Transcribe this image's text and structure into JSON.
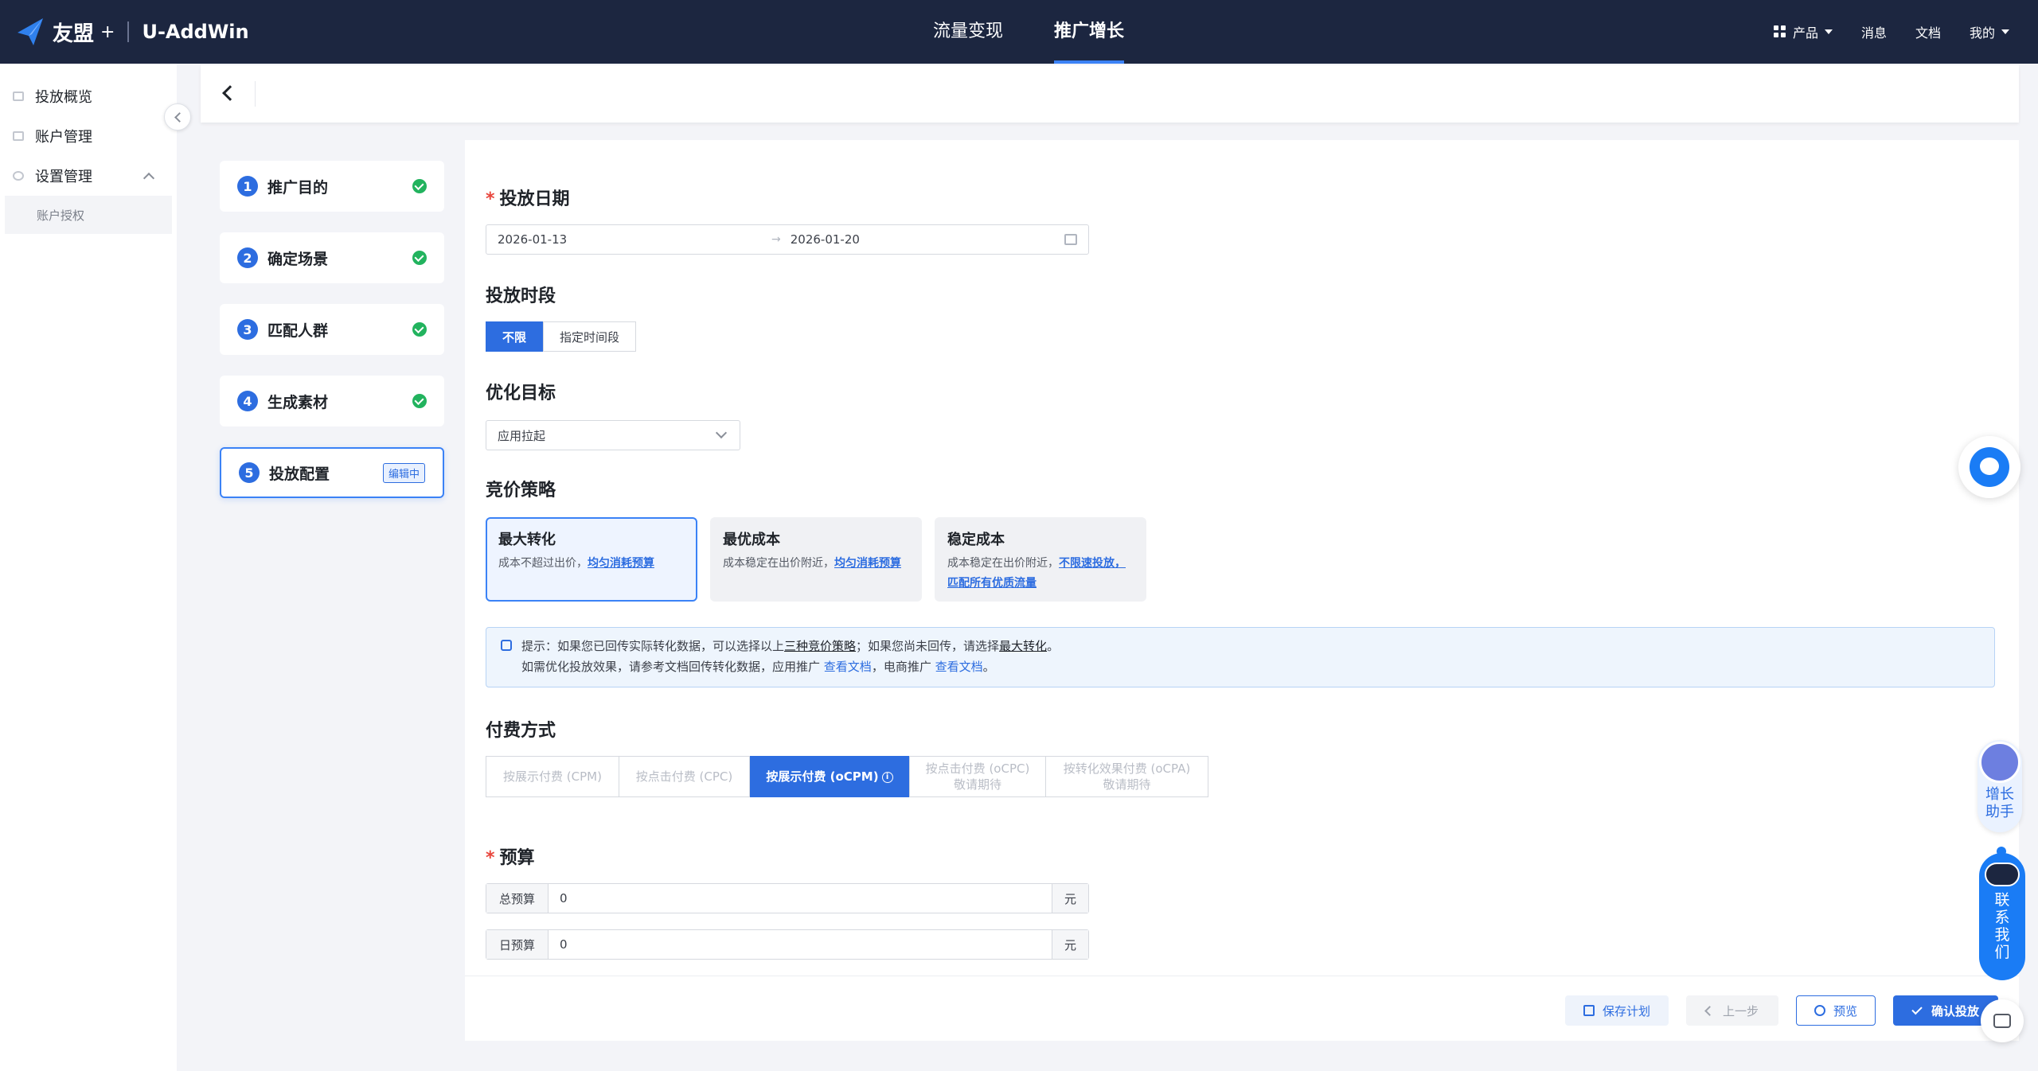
{
  "header": {
    "brand": "友盟",
    "brand_plus": "+",
    "app_name": "U-AddWin",
    "nav": [
      "流量变现",
      "推广增长"
    ],
    "active_nav": "推广增长",
    "right": {
      "product": "产品",
      "messages": "消息",
      "docs": "文档",
      "mine": "我的"
    }
  },
  "sidebar": {
    "items": [
      {
        "label": "投放概览"
      },
      {
        "label": "账户管理"
      },
      {
        "label": "设置管理"
      }
    ],
    "sub_items": [
      {
        "label": "账户授权"
      }
    ]
  },
  "steps": [
    {
      "num": "1",
      "label": "推广目的",
      "status": "done"
    },
    {
      "num": "2",
      "label": "确定场景",
      "status": "done"
    },
    {
      "num": "3",
      "label": "匹配人群",
      "status": "done"
    },
    {
      "num": "4",
      "label": "生成素材",
      "status": "done"
    },
    {
      "num": "5",
      "label": "投放配置",
      "status": "editing",
      "badge": "编辑中"
    }
  ],
  "form": {
    "date": {
      "label": "投放日期",
      "start": "2026-01-13",
      "arrow": "→",
      "end": "2026-01-20"
    },
    "time_slot": {
      "label": "投放时段",
      "options": [
        "不限",
        "指定时间段"
      ],
      "selected": "不限"
    },
    "goal": {
      "label": "优化目标",
      "value": "应用拉起"
    },
    "bid_strategy": {
      "label": "竞价策略",
      "options": [
        {
          "title": "最大转化",
          "desc": "成本不超过出价，",
          "link": "均匀消耗预算",
          "desc2": ""
        },
        {
          "title": "最优成本",
          "desc": "成本稳定在出价附近，",
          "link": "均匀消耗预算",
          "desc2": ""
        },
        {
          "title": "稳定成本",
          "desc": "成本稳定在出价附近，",
          "link": "不限速投放，匹配所有优质流量",
          "desc2": ""
        }
      ],
      "selected": "最大转化"
    },
    "tip": {
      "line1_a": "提示：如果您已回传实际转化数据，可以选择以上",
      "line1_u1": "三种竞价策略",
      "line1_b": "；如果您尚未回传，请选择",
      "line1_u2": "最大转化",
      "line1_c": "。",
      "line2_a": "如需优化投放效果，请参考文档回传转化数据，应用推广",
      "line2_link1": "查看文档",
      "line2_b": "，电商推广",
      "line2_link2": "查看文档",
      "line2_c": "。"
    },
    "payment": {
      "label": "付费方式",
      "options": [
        {
          "label": "按展示付费 (CPM)",
          "sub": ""
        },
        {
          "label": "按点击付费 (CPC)",
          "sub": ""
        },
        {
          "label": "按展示付费 (oCPM)",
          "sub": ""
        },
        {
          "label": "按点击付费 (oCPC)",
          "sub": "敬请期待"
        },
        {
          "label": "按转化效果付费 (oCPA)",
          "sub": "敬请期待"
        }
      ],
      "selected": "按展示付费 (oCPM)",
      "info_glyph": "i"
    },
    "budget": {
      "label": "预算",
      "total_label": "总预算",
      "total_value": "0",
      "daily_label": "日预算",
      "daily_value": "0",
      "unit": "元"
    }
  },
  "footer": {
    "save": "保存计划",
    "prev": "上一步",
    "preview": "预览",
    "confirm": "确认投放"
  },
  "floating": {
    "assistant": "增长助手",
    "contact": "联系我们"
  },
  "colors": {
    "topbar": "#1c2640",
    "primary": "#2d6de0",
    "success": "#22b35e",
    "required": "#e8453c"
  }
}
